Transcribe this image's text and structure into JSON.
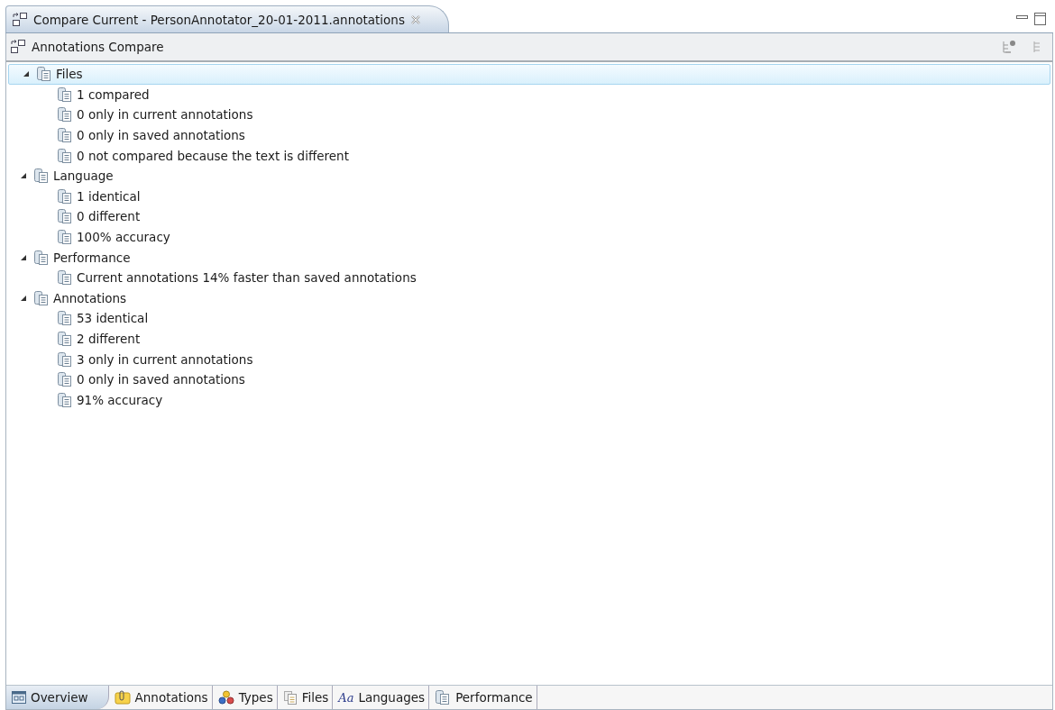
{
  "editor_tab": {
    "title": "Compare Current - PersonAnnotator_20-01-2011.annotations"
  },
  "view": {
    "title": "Annotations Compare"
  },
  "tree": [
    {
      "label": "Files",
      "expanded": true,
      "selected": true,
      "children": [
        {
          "label": "1 compared"
        },
        {
          "label": "0 only in current annotations"
        },
        {
          "label": "0 only in saved annotations"
        },
        {
          "label": "0 not compared because the text is different"
        }
      ]
    },
    {
      "label": "Language",
      "expanded": true,
      "selected": false,
      "children": [
        {
          "label": "1 identical"
        },
        {
          "label": "0 different"
        },
        {
          "label": "100% accuracy"
        }
      ]
    },
    {
      "label": "Performance",
      "expanded": true,
      "selected": false,
      "children": [
        {
          "label": "Current annotations 14% faster than saved annotations"
        }
      ]
    },
    {
      "label": "Annotations",
      "expanded": true,
      "selected": false,
      "children": [
        {
          "label": "53 identical"
        },
        {
          "label": "2 different"
        },
        {
          "label": "3 only in current annotations"
        },
        {
          "label": "0 only in saved annotations"
        },
        {
          "label": "91% accuracy"
        }
      ]
    }
  ],
  "page_tabs": [
    {
      "label": "Overview",
      "kind": "overview",
      "selected": true
    },
    {
      "label": "Annotations",
      "kind": "annotations",
      "selected": false
    },
    {
      "label": "Types",
      "kind": "types",
      "selected": false
    },
    {
      "label": "Files",
      "kind": "files",
      "selected": false
    },
    {
      "label": "Languages",
      "kind": "languages",
      "glyph": "Aa",
      "selected": false
    },
    {
      "label": "Performance",
      "kind": "performance",
      "selected": false
    }
  ]
}
